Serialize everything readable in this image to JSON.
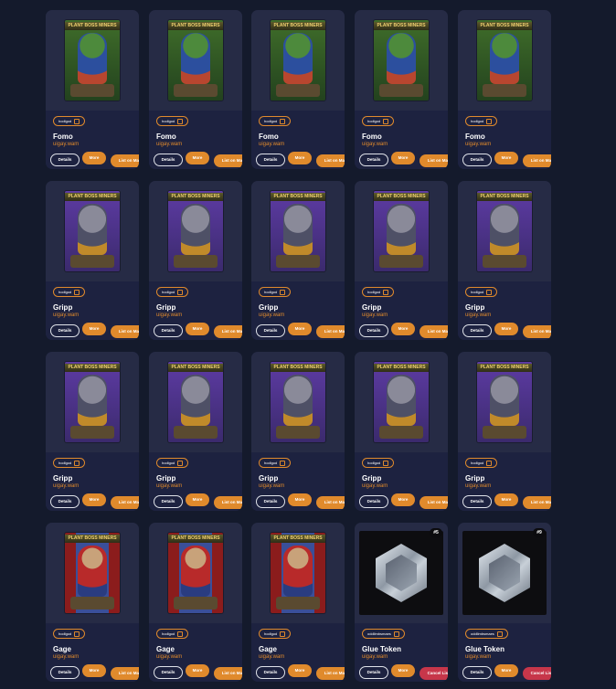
{
  "cards": [
    {
      "kind": "fomo",
      "name": "Fomo",
      "owner": "uigay.wam",
      "tag": "hodlgod",
      "edition": "",
      "details": "Details",
      "more": "More",
      "action": "List on Market",
      "action_type": "list"
    },
    {
      "kind": "fomo",
      "name": "Fomo",
      "owner": "uigay.wam",
      "tag": "hodlgod",
      "edition": "",
      "details": "Details",
      "more": "More",
      "action": "List on Market",
      "action_type": "list"
    },
    {
      "kind": "fomo",
      "name": "Fomo",
      "owner": "uigay.wam",
      "tag": "hodlgod",
      "edition": "",
      "details": "Details",
      "more": "More",
      "action": "List on Market",
      "action_type": "list"
    },
    {
      "kind": "fomo",
      "name": "Fomo",
      "owner": "uigay.wam",
      "tag": "hodlgod",
      "edition": "",
      "details": "Details",
      "more": "More",
      "action": "List on Market",
      "action_type": "list"
    },
    {
      "kind": "fomo",
      "name": "Fomo",
      "owner": "uigay.wam",
      "tag": "hodlgod",
      "edition": "",
      "details": "Details",
      "more": "More",
      "action": "List on Market",
      "action_type": "list"
    },
    {
      "kind": "gripp",
      "name": "Gripp",
      "owner": "uigay.wam",
      "tag": "hodlgod",
      "edition": "",
      "details": "Details",
      "more": "More",
      "action": "List on Market",
      "action_type": "list"
    },
    {
      "kind": "gripp",
      "name": "Gripp",
      "owner": "uigay.wam",
      "tag": "hodlgod",
      "edition": "",
      "details": "Details",
      "more": "More",
      "action": "List on Market",
      "action_type": "list"
    },
    {
      "kind": "gripp",
      "name": "Gripp",
      "owner": "uigay.wam",
      "tag": "hodlgod",
      "edition": "",
      "details": "Details",
      "more": "More",
      "action": "List on Market",
      "action_type": "list"
    },
    {
      "kind": "gripp",
      "name": "Gripp",
      "owner": "uigay.wam",
      "tag": "hodlgod",
      "edition": "",
      "details": "Details",
      "more": "More",
      "action": "List on Market",
      "action_type": "list"
    },
    {
      "kind": "gripp",
      "name": "Gripp",
      "owner": "uigay.wam",
      "tag": "hodlgod",
      "edition": "",
      "details": "Details",
      "more": "More",
      "action": "List on Market",
      "action_type": "list"
    },
    {
      "kind": "gripp",
      "name": "Gripp",
      "owner": "uigay.wam",
      "tag": "hodlgod",
      "edition": "",
      "details": "Details",
      "more": "More",
      "action": "List on Market",
      "action_type": "list"
    },
    {
      "kind": "gripp",
      "name": "Gripp",
      "owner": "uigay.wam",
      "tag": "hodlgod",
      "edition": "",
      "details": "Details",
      "more": "More",
      "action": "List on Market",
      "action_type": "list"
    },
    {
      "kind": "gripp",
      "name": "Gripp",
      "owner": "uigay.wam",
      "tag": "hodlgod",
      "edition": "",
      "details": "Details",
      "more": "More",
      "action": "List on Market",
      "action_type": "list"
    },
    {
      "kind": "gripp",
      "name": "Gripp",
      "owner": "uigay.wam",
      "tag": "hodlgod",
      "edition": "",
      "details": "Details",
      "more": "More",
      "action": "List on Market",
      "action_type": "list"
    },
    {
      "kind": "gripp",
      "name": "Gripp",
      "owner": "uigay.wam",
      "tag": "hodlgod",
      "edition": "",
      "details": "Details",
      "more": "More",
      "action": "List on Market",
      "action_type": "list"
    },
    {
      "kind": "gage",
      "name": "Gage",
      "owner": "uigay.wam",
      "tag": "hodlgod",
      "edition": "",
      "details": "Details",
      "more": "More",
      "action": "List on Market",
      "action_type": "list"
    },
    {
      "kind": "gage",
      "name": "Gage",
      "owner": "uigay.wam",
      "tag": "hodlgod",
      "edition": "",
      "details": "Details",
      "more": "More",
      "action": "List on Market",
      "action_type": "list"
    },
    {
      "kind": "gage",
      "name": "Gage",
      "owner": "uigay.wam",
      "tag": "hodlgod",
      "edition": "",
      "details": "Details",
      "more": "More",
      "action": "List on Market",
      "action_type": "list"
    },
    {
      "kind": "token",
      "name": "Glue Token",
      "owner": "uigay.wam",
      "tag": "oddlimbsmaes",
      "edition": "#5",
      "details": "Details",
      "more": "More",
      "action": "Cancel Listing",
      "action_type": "cancel"
    },
    {
      "kind": "token",
      "name": "Glue Token",
      "owner": "uigay.wam",
      "tag": "oddlimbsmaes",
      "edition": "#9",
      "details": "Details",
      "more": "More",
      "action": "Cancel Listing",
      "action_type": "cancel"
    }
  ],
  "card_banner": "PLANT BOSS MINERS",
  "colors": {
    "background": "#141a2c",
    "card": "#1c2139",
    "accent": "#e08a2c",
    "cancel": "#c7364a"
  }
}
